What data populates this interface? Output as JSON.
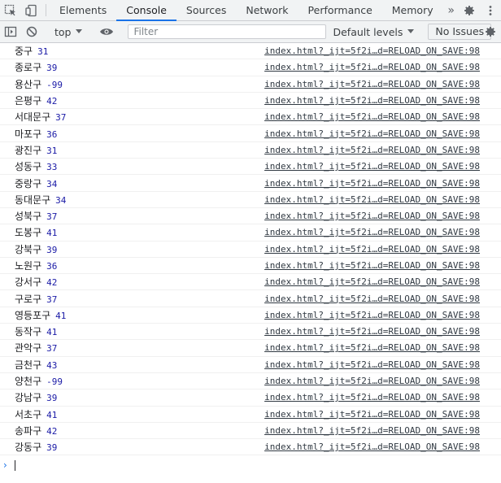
{
  "tabs": [
    "Elements",
    "Console",
    "Sources",
    "Network",
    "Performance",
    "Memory"
  ],
  "tabs_more": "»",
  "toolbar": {
    "context": "top",
    "filter_placeholder": "Filter",
    "levels": "Default levels",
    "issues": "No Issues"
  },
  "rows": [
    {
      "name": "중구",
      "value": "31"
    },
    {
      "name": "종로구",
      "value": "39"
    },
    {
      "name": "용산구",
      "value": "-99"
    },
    {
      "name": "은평구",
      "value": "42"
    },
    {
      "name": "서대문구",
      "value": "37"
    },
    {
      "name": "마포구",
      "value": "36"
    },
    {
      "name": "광진구",
      "value": "31"
    },
    {
      "name": "성동구",
      "value": "33"
    },
    {
      "name": "중랑구",
      "value": "34"
    },
    {
      "name": "동대문구",
      "value": "34"
    },
    {
      "name": "성북구",
      "value": "37"
    },
    {
      "name": "도봉구",
      "value": "41"
    },
    {
      "name": "강북구",
      "value": "39"
    },
    {
      "name": "노원구",
      "value": "36"
    },
    {
      "name": "강서구",
      "value": "42"
    },
    {
      "name": "구로구",
      "value": "37"
    },
    {
      "name": "영등포구",
      "value": "41"
    },
    {
      "name": "동작구",
      "value": "41"
    },
    {
      "name": "관악구",
      "value": "37"
    },
    {
      "name": "금천구",
      "value": "43"
    },
    {
      "name": "양천구",
      "value": "-99"
    },
    {
      "name": "강남구",
      "value": "39"
    },
    {
      "name": "서초구",
      "value": "41"
    },
    {
      "name": "송파구",
      "value": "42"
    },
    {
      "name": "강동구",
      "value": "39"
    }
  ],
  "source_link": "index.html?_ijt=5f2i…d=RELOAD_ON_SAVE:98",
  "prompt_symbol": "›"
}
